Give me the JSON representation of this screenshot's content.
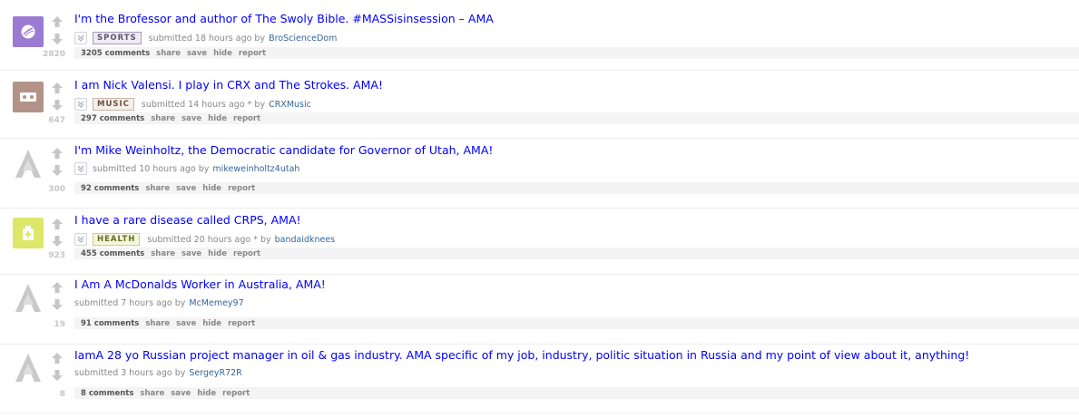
{
  "colors": {
    "link": "#0000ff",
    "author": "#336699",
    "meta": "#888888",
    "score": "#c6c6c6",
    "bar": "#f4f4f4",
    "arrow": "#c6c6c6"
  },
  "actions": {
    "share": "share",
    "save": "save",
    "hide": "hide",
    "report": "report"
  },
  "posts": [
    {
      "title": "I'm the Brofessor and author of The Swoly Bible. #MASSisinsession – AMA",
      "flair": "SPORTS",
      "submitted": "submitted 18 hours ago by",
      "author": "BroScienceDom",
      "score": "2820",
      "comments": "3205 comments",
      "thumb_icon": "sports-icon"
    },
    {
      "title": "I am Nick Valensi. I play in CRX and The Strokes. AMA!",
      "flair": "MUSIC",
      "submitted": "submitted 14 hours ago * by",
      "author": "CRXMusic",
      "score": "647",
      "comments": "297 comments",
      "thumb_icon": "music-icon"
    },
    {
      "title": "I'm Mike Weinholtz, the Democratic candidate for Governor of Utah, AMA!",
      "flair": "",
      "submitted": "submitted 10 hours ago by",
      "author": "mikeweinholtz4utah",
      "score": "300",
      "comments": "92 comments",
      "thumb_icon": "default-thumbnail-icon"
    },
    {
      "title": "I have a rare disease called CRPS, AMA!",
      "flair": "HEALTH",
      "submitted": "submitted 20 hours ago * by",
      "author": "bandaidknees",
      "score": "923",
      "comments": "455 comments",
      "thumb_icon": "health-icon"
    },
    {
      "title": "I Am A McDonalds Worker in Australia, AMA!",
      "flair": "",
      "submitted": "submitted 7 hours ago by",
      "author": "McMemey97",
      "score": "19",
      "comments": "91 comments",
      "thumb_icon": "default-thumbnail-icon"
    },
    {
      "title": "IamA 28 yo Russian project manager in oil & gas industry. AMA specific of my job, industry, politic situation in Russia and my point of view about it, anything!",
      "flair": "",
      "submitted": "submitted 3 hours ago by",
      "author": "SergeyR72R",
      "score": "8",
      "comments": "8 comments",
      "thumb_icon": "default-thumbnail-icon"
    }
  ]
}
